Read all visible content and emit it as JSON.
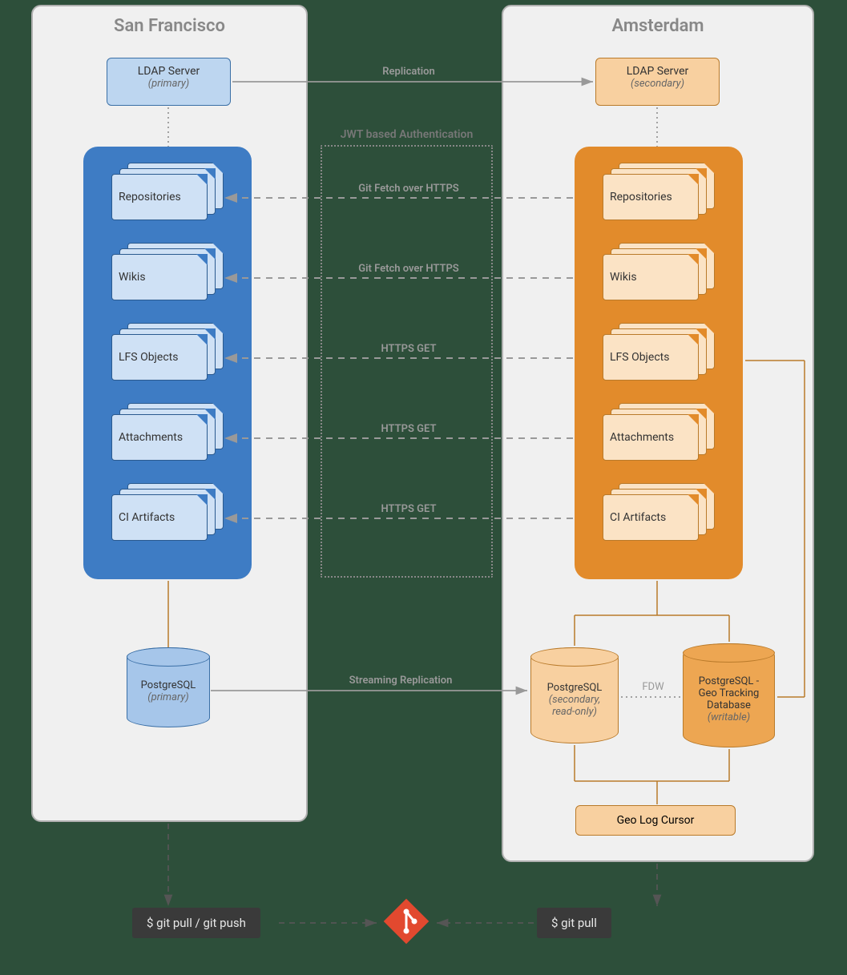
{
  "regions": {
    "sf": "San Francisco",
    "am": "Amsterdam"
  },
  "ldap": {
    "primary": {
      "title": "LDAP Server",
      "sub": "(primary)"
    },
    "secondary": {
      "title": "LDAP Server",
      "sub": "(secondary)"
    }
  },
  "services": [
    "Repositories",
    "Wikis",
    "LFS Objects",
    "Attachments",
    "CI Artifacts"
  ],
  "jwt_label": "JWT based Authentication",
  "conn_labels": {
    "replication": "Replication",
    "git_fetch": "Git Fetch over HTTPS",
    "https_get": "HTTPS GET",
    "streaming": "Streaming Replication",
    "fdw": "FDW"
  },
  "db": {
    "primary": {
      "title": "PostgreSQL",
      "sub": "(primary)"
    },
    "secondary": {
      "title": "PostgreSQL",
      "sub1": "(secondary,",
      "sub2": "read-only)"
    },
    "geo": {
      "title": "PostgreSQL -",
      "l2": "Geo Tracking",
      "l3": "Database",
      "sub": "(writable)"
    }
  },
  "geo_log": "Geo Log Cursor",
  "cmds": {
    "pullpush": "$ git pull / git push",
    "pull": "$ git pull"
  }
}
